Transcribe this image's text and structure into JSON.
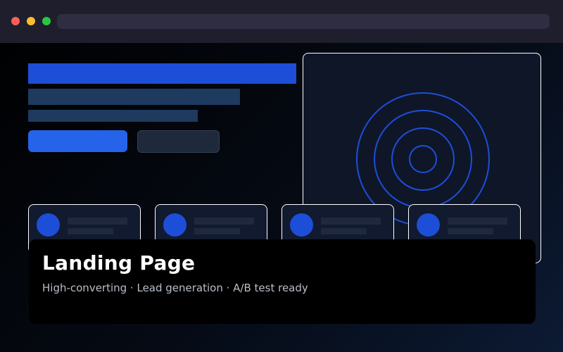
{
  "window": {
    "controls": [
      "close",
      "minimize",
      "maximize"
    ]
  },
  "hero": {
    "title": "Landing Page",
    "subtitle": "High-converting · Lead generation · A/B test ready"
  },
  "colors": {
    "accent": "#2563eb",
    "accent_dark": "#1d4ed8",
    "ring": "#1d4ed8",
    "background": "#000000",
    "chrome": "#1f1e2d"
  },
  "feature_cards": [
    {
      "icon": "avatar-circle"
    },
    {
      "icon": "avatar-circle"
    },
    {
      "icon": "avatar-circle"
    },
    {
      "icon": "avatar-circle"
    }
  ]
}
